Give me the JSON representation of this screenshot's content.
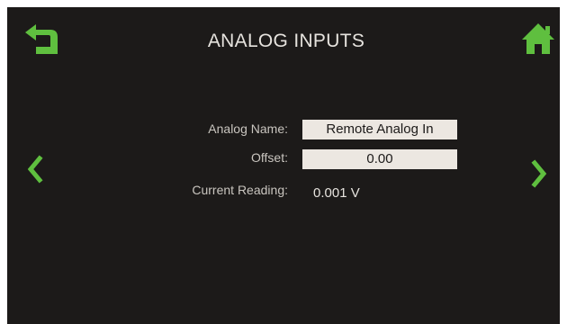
{
  "header": {
    "title": "ANALOG INPUTS",
    "back_icon": "back-arrow-icon",
    "home_icon": "home-icon"
  },
  "nav": {
    "prev_icon": "chevron-left-icon",
    "next_icon": "chevron-right-icon"
  },
  "form": {
    "analog_name_label": "Analog Name:",
    "analog_name_value": "Remote Analog In",
    "offset_label": "Offset:",
    "offset_value": "0.00",
    "current_reading_label": "Current Reading:",
    "current_reading_value": "0.001 V"
  },
  "colors": {
    "background": "#1c1a19",
    "accent_green": "#5fbf3f",
    "field_background": "#ece7e1",
    "text": "#e6e3de"
  }
}
